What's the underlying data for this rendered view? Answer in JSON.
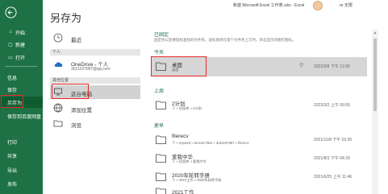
{
  "window": {
    "doc_title": "新建 Microsoft Excel 工作表.xlsx - Excel",
    "user": "re 无限",
    "help": "?"
  },
  "page_title": "另存为",
  "rail": {
    "items": [
      {
        "label": "开始",
        "icon": "home-icon"
      },
      {
        "label": "新建",
        "icon": "new-doc-icon"
      },
      {
        "label": "打开",
        "icon": "folder-open-icon"
      },
      {
        "label": "信息",
        "icon": ""
      },
      {
        "label": "保存",
        "icon": ""
      },
      {
        "label": "另存为",
        "icon": ""
      },
      {
        "label": "保存到百度网盘",
        "icon": ""
      },
      {
        "label": "打印",
        "icon": ""
      },
      {
        "label": "共享",
        "icon": ""
      },
      {
        "label": "导出",
        "icon": ""
      },
      {
        "label": "发布",
        "icon": ""
      }
    ]
  },
  "locations": {
    "recent": "最近",
    "personal_header": "个人",
    "onedrive_name": "OneDrive - 个人",
    "onedrive_email": "3011197087@qq.com",
    "other_header": "其他位置",
    "this_pc": "这台电脑",
    "add_place": "添加位置",
    "browse": "浏览"
  },
  "pinned": {
    "title": "已固定",
    "hint": "固定你以后要轻松查找的文件夹。鼠标悬停在某个文件夹上方时，单击显示的图钉图标。"
  },
  "groups": {
    "today": "今天",
    "last_week": "上周",
    "older": "更早"
  },
  "folders": [
    {
      "name": "桌面",
      "path": "桌面",
      "date": "2022/3/8 下午 12:05"
    },
    {
      "name": "2计划",
      "path": "下 » 信息库 » 2计划",
      "date": "2022/3/2 上午 09:55"
    },
    {
      "name": "filerecv",
      "path": "下 » mywxrd » tencent files » 3011197087 » filerecv",
      "date": "2021/11/8 下午 03:35"
    },
    {
      "name": "爱我中华",
      "path": "下 » 信息库 » 爱我中华",
      "date": "2021/8/3 下午 04:29"
    },
    {
      "name": "2020年轮转手册",
      "path": "下 » 2021工作 » 2020年轮转手册",
      "date": "2021/6/25 上午 11:46"
    },
    {
      "name": "2021工作",
      "path": "",
      "date": ""
    }
  ],
  "colors": {
    "accent": "#1e7145",
    "highlight": "#e8262b"
  }
}
